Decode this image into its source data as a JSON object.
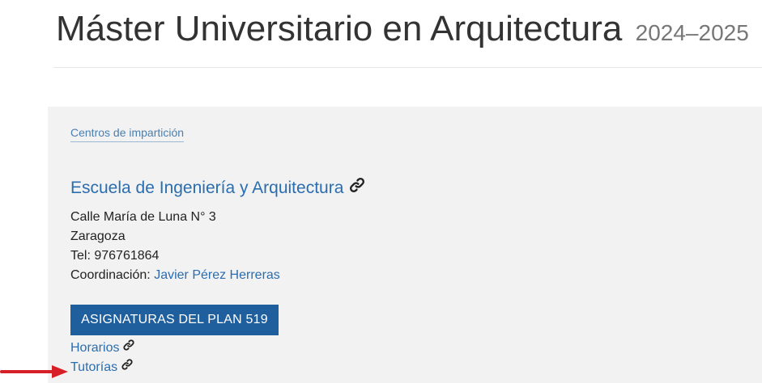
{
  "header": {
    "title": "Máster Universitario en Arquitectura",
    "year": "2024–2025"
  },
  "centers": {
    "section_label": "Centros de impartición",
    "school_name": "Escuela de Ingeniería y Arquitectura",
    "address_line": "Calle María de Luna N° 3",
    "city": "Zaragoza",
    "tel": "Tel: 976761864",
    "coordination_label": "Coordinación:",
    "coordinator": "Javier Pérez Herreras",
    "plan_button": "ASIGNATURAS DEL PLAN 519",
    "links": [
      {
        "label": "Horarios",
        "icon": "link-icon"
      },
      {
        "label": "Tutorías",
        "icon": "link-icon"
      }
    ]
  },
  "annotation": {
    "arrow_icon": "red-arrow-icon",
    "arrow_color": "#d61f26"
  },
  "colors": {
    "link": "#2a6db0",
    "button_bg": "#1f5f9e",
    "panel_bg": "#f2f2f2"
  }
}
